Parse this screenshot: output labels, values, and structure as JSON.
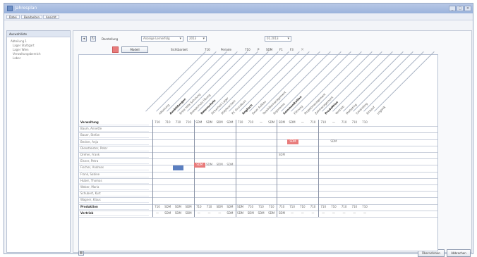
{
  "window": {
    "title": "Jahresplan",
    "minimize": "_",
    "maximize": "□",
    "close": "×"
  },
  "menubar": {
    "items": [
      "Datei",
      "Bearbeiten",
      "Ansicht"
    ]
  },
  "left_panel": {
    "title": "Auswahlliste",
    "close": "×",
    "items": [
      "Abteilung 1",
      "Lager Stuttgart",
      "Lager Wien",
      "Verwaltungsbereich",
      "Labor"
    ]
  },
  "toolbar": {
    "label_view": "Darstellung",
    "view_value": "Anzeige Lernerfolg",
    "year_value": "2013",
    "date_label": "01.2013",
    "model_button": "Modell",
    "row_label_text": "Sichtbarkeit",
    "sum_value": "710",
    "period_label": "Periode",
    "p1": "710",
    "p2": "P",
    "p3": "SDM",
    "p4": "F1",
    "p5": "F3"
  },
  "columns": [
    "Abteilung",
    "Ausbildungen",
    "Erste Hilfe Schulung",
    "Brandschutz Übung",
    "Datenschutz",
    "Sicherheit Lager",
    "Staplerschein",
    "PC Grundkurs",
    "Englisch",
    "Excel Aufbau",
    "Qualitätsmanagement",
    "Ergonomie",
    "Kommunikation",
    "Führung",
    "Projektmanagement",
    "Zeitmanagement",
    "Produktion",
    "Vertrieb",
    "Marketing",
    "Controlling",
    "Einkauf",
    "Logistik"
  ],
  "bold_columns": [
    1,
    4,
    8,
    12,
    16
  ],
  "rows": [
    "Verwaltung",
    "Baum, Annette",
    "Bauer, Stefan",
    "Becker, Anja",
    "Dienstleister, Peter",
    "Dreher, Frank",
    "Elsner, Petra",
    "Fischer, Andreas",
    "Frank, Sabine",
    "Huber, Thomas",
    "Weber, Maria",
    "Schubert, Kurt",
    "Wagner, Klaus",
    "Produktion",
    "Vertrieb"
  ],
  "bold_rows": [
    0,
    13,
    14
  ],
  "header_values": [
    "710",
    "710",
    "710",
    "710",
    "SDM",
    "SDM",
    "SDM",
    "SDM",
    "710",
    "710",
    "—",
    "SDM",
    "SDM",
    "SDM",
    "—",
    "710",
    "710",
    "—",
    "710",
    "710",
    "710"
  ],
  "production_values": [
    "710",
    "SDM",
    "SDM",
    "SDM",
    "710",
    "710",
    "SDM",
    "SDM",
    "SDM",
    "710",
    "710",
    "710",
    "710",
    "710",
    "710",
    "710",
    "710",
    "710",
    "710",
    "710",
    "710"
  ],
  "sales_values": [
    "—",
    "SDM",
    "SDM",
    "SDM",
    "—",
    "—",
    "—",
    "SDM",
    "SDM",
    "SDM",
    "SDM",
    "SDM",
    "SDM",
    "—",
    "—",
    "—",
    "—",
    "—",
    "—",
    "—",
    "—"
  ],
  "marks": {
    "becker_red": "SDM",
    "becker_dash": "SDM",
    "dreher": "SDM",
    "fischer_blue": "",
    "fischer_red": "SDM",
    "fischer_vals": [
      "SDM",
      "SDM",
      "SDM"
    ]
  },
  "footer": {
    "ok": "Übernehmen",
    "cancel": "Abbrechen"
  },
  "colors": {
    "accent": "#9ab3dc",
    "mark_red": "#e87b7b",
    "mark_blue": "#5b7fc0"
  }
}
